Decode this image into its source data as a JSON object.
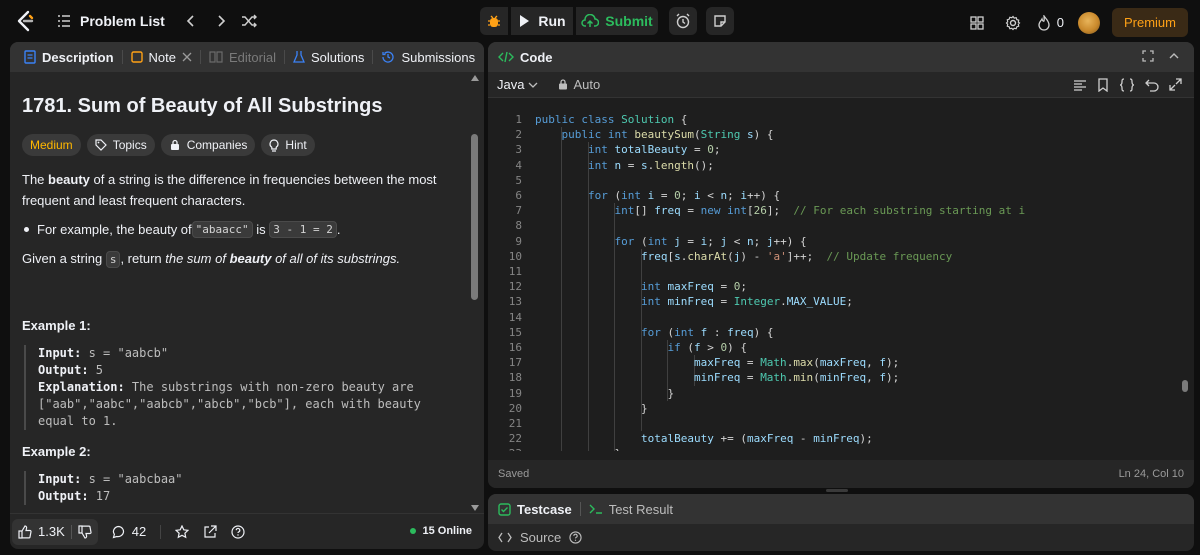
{
  "topbar": {
    "problem_list_label": "Problem List",
    "run_label": "Run",
    "submit_label": "Submit",
    "streak_count": "0",
    "premium_label": "Premium"
  },
  "left_tabs": {
    "description": "Description",
    "note": "Note",
    "editorial": "Editorial",
    "solutions": "Solutions",
    "submissions": "Submissions"
  },
  "problem": {
    "title": "1781. Sum of Beauty of All Substrings",
    "difficulty": "Medium",
    "tags": [
      "Topics",
      "Companies",
      "Hint"
    ],
    "p1_a": "The ",
    "p1_b": "beauty",
    "p1_c": " of a string is the difference in frequencies between the most frequent and least frequent characters.",
    "bullet_a": "For example, the beauty of ",
    "bullet_code1": "\"abaacc\"",
    "bullet_b": " is ",
    "bullet_code2": "3 - 1 = 2",
    "bullet_c": ".",
    "p2_a": "Given a string ",
    "p2_code": "s",
    "p2_b": ", return ",
    "p2_c": "the sum of ",
    "p2_d": "beauty",
    "p2_e": " of all of its substrings.",
    "example1_title": "Example 1:",
    "ex1_input_label": "Input:",
    "ex1_input": " s = \"aabcb\"",
    "ex1_output_label": "Output:",
    "ex1_output": " 5",
    "ex1_expl_label": "Explanation:",
    "ex1_expl_1": " The substrings with non-zero beauty are",
    "ex1_expl_2": "[\"aab\",\"aabc\",\"aabcb\",\"abcb\",\"bcb\"], each with beauty",
    "ex1_expl_3": "equal to 1.",
    "example2_title": "Example 2:",
    "ex2_input_label": "Input:",
    "ex2_input": " s = \"aabcbaa\"",
    "ex2_output_label": "Output:",
    "ex2_output": " 17"
  },
  "left_bottom": {
    "likes": "1.3K",
    "comments": "42",
    "online": "15 Online"
  },
  "code_panel": {
    "title": "Code",
    "language": "Java",
    "mode": "Auto",
    "status_left": "Saved",
    "status_right": "Ln 24, Col 10",
    "lines": [
      "public class Solution {",
      "    public int beautySum(String s) {",
      "        int totalBeauty = 0;",
      "        int n = s.length();",
      "",
      "        for (int i = 0; i < n; i++) {",
      "            int[] freq = new int[26];  // For each substring starting at i",
      "",
      "            for (int j = i; j < n; j++) {",
      "                freq[s.charAt(j) - 'a']++;  // Update frequency",
      "",
      "                int maxFreq = 0;",
      "                int minFreq = Integer.MAX_VALUE;",
      "",
      "                for (int f : freq) {",
      "                    if (f > 0) {",
      "                        maxFreq = Math.max(maxFreq, f);",
      "                        minFreq = Math.min(minFreq, f);",
      "                    }",
      "                }",
      "",
      "                totalBeauty += (maxFreq - minFreq);",
      "            }"
    ]
  },
  "test_panel": {
    "testcase_label": "Testcase",
    "result_label": "Test Result",
    "source_label": "Source"
  }
}
